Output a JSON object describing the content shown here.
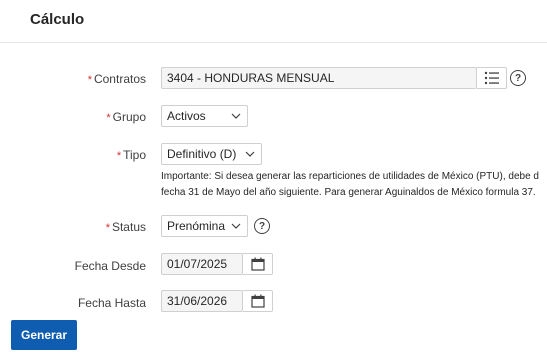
{
  "header": {
    "title": "Cálculo"
  },
  "form": {
    "contratos": {
      "label": "Contratos",
      "value": "3404 - HONDURAS MENSUAL",
      "required": true
    },
    "grupo": {
      "label": "Grupo",
      "value": "Activos",
      "required": true
    },
    "tipo": {
      "label": "Tipo",
      "value": "Definitivo (D)",
      "required": true,
      "note_line1": "Importante: Si desea generar las reparticiones de utilidades de México (PTU), debe d",
      "note_line2": "fecha 31 de Mayo del año siguiente. Para generar Aguinaldos de México formula 37."
    },
    "status": {
      "label": "Status",
      "value": "Prenómina",
      "required": true
    },
    "fecha_desde": {
      "label": "Fecha Desde",
      "value": "01/07/2025"
    },
    "fecha_hasta": {
      "label": "Fecha Hasta",
      "value": "31/06/2026"
    },
    "required_marker": "*",
    "help_glyph": "?"
  },
  "actions": {
    "generar_label": "Generar"
  },
  "icons": {
    "list": "list-icon",
    "help": "help-icon",
    "calendar": "calendar-icon",
    "chevron": "chevron-down-icon"
  },
  "colors": {
    "accent": "#0f5db1",
    "required": "#d32f2f"
  }
}
